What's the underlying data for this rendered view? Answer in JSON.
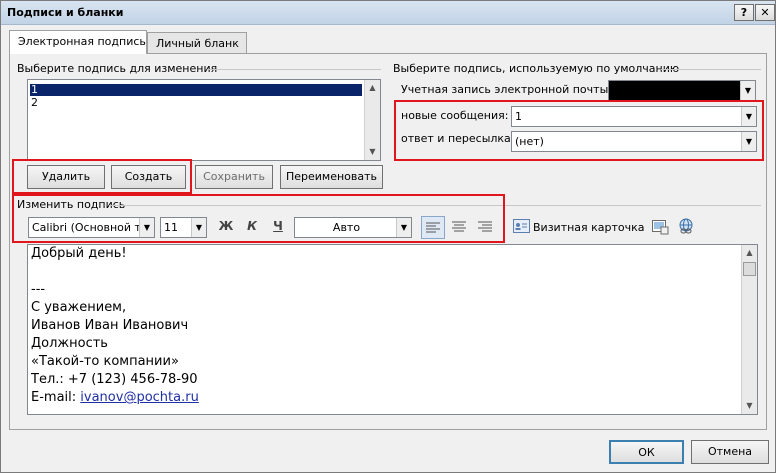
{
  "window": {
    "title": "Подписи и бланки",
    "help": "?",
    "close": "✕"
  },
  "tabs": [
    "Электронная подпись",
    "Личный бланк"
  ],
  "select_group": {
    "label": "Выберите подпись для изменения"
  },
  "signatures": [
    {
      "name": "1",
      "selected": true
    },
    {
      "name": "2",
      "selected": false
    }
  ],
  "list_buttons": {
    "delete": "Удалить",
    "create": "Создать",
    "save": "Сохранить",
    "rename": "Переименовать"
  },
  "default_group": {
    "label": "Выберите подпись, используемую по умолчанию",
    "account_label": "Учетная запись электронной почты:",
    "account_value": "",
    "new_messages_label": "новые сообщения:",
    "new_messages_value": "1",
    "reply_label": "ответ и пересылка:",
    "reply_value": "(нет)"
  },
  "edit_group": {
    "label": "Изменить подпись",
    "font": "Calibri (Основной те",
    "size": "11",
    "bold": "Ж",
    "italic": "К",
    "underline": "Ч",
    "color": "Авто",
    "business_card": "Визитная карточка"
  },
  "signature_text": {
    "line1": "Добрый день!",
    "line2": "---",
    "line3": "С уважением,",
    "line4": "Иванов Иван Иванович",
    "line5": "Должность",
    "line6": "«Такой-то компании»",
    "line7": "Тел.: +7 (123) 456-78-90",
    "email_label": "E-mail: ",
    "email": "ivanov@pochta.ru"
  },
  "footer": {
    "ok": "ОК",
    "cancel": "Отмена"
  },
  "colors": {
    "highlight": "#e0161c",
    "selection": "#0a246a",
    "link": "#1f2fa8"
  }
}
